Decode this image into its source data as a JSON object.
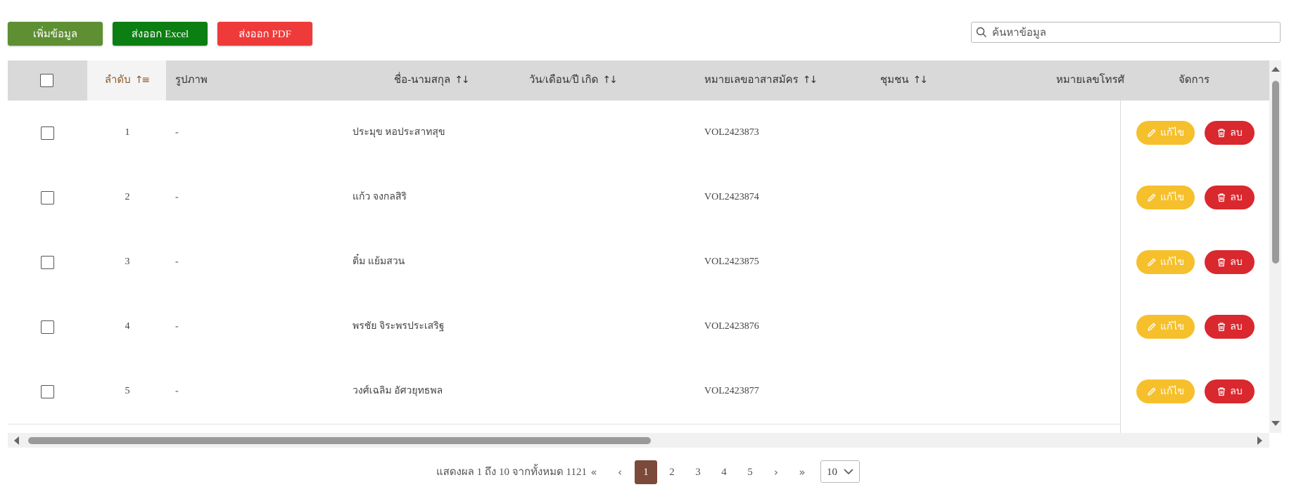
{
  "toolbar": {
    "add_label": "เพิ่มข้อมูล",
    "excel_label": "ส่งออก Excel",
    "pdf_label": "ส่งออก PDF"
  },
  "search": {
    "placeholder": "ค้นหาข้อมูล",
    "value": ""
  },
  "table": {
    "headers": {
      "index": "ลำดับ",
      "photo": "รูปภาพ",
      "name": "ชื่อ-นามสกุล",
      "birthdate": "วัน/เดือน/ปี เกิด",
      "volunteer_no": "หมายเลขอาสาสมัคร",
      "community": "ชุมชน",
      "phone": "หมายเลขโทรศั",
      "actions": "จัดการ"
    },
    "sort_asc_icon": "↑≡",
    "sort_icon": "↑↓",
    "rows": [
      {
        "index": "1",
        "photo": "-",
        "name": "ประมุข หอประสาทสุข",
        "volunteer_no": "VOL2423873"
      },
      {
        "index": "2",
        "photo": "-",
        "name": "แก้ว จงกลสิริ",
        "volunteer_no": "VOL2423874"
      },
      {
        "index": "3",
        "photo": "-",
        "name": "ติ๋ม แย้มสวน",
        "volunteer_no": "VOL2423875"
      },
      {
        "index": "4",
        "photo": "-",
        "name": "พรชัย จิระพรประเสริฐ",
        "volunteer_no": "VOL2423876"
      },
      {
        "index": "5",
        "photo": "-",
        "name": "วงศ์เฉลิม อัศวยุทธพล",
        "volunteer_no": "VOL2423877"
      }
    ],
    "edit_label": "แก้ไข",
    "delete_label": "ลบ"
  },
  "pagination": {
    "info": "แสดงผล 1 ถึง 10 จากทั้งหมด 1121",
    "first": "«",
    "prev": "‹",
    "pages": [
      "1",
      "2",
      "3",
      "4",
      "5"
    ],
    "current": "1",
    "next": "›",
    "last": "»",
    "page_size": "10"
  },
  "colors": {
    "add": "#5e8f32",
    "excel": "#0b7f12",
    "pdf": "#ef3a3a",
    "edit": "#f6c02c",
    "delete": "#d9282e",
    "active_page": "#7b4a3a"
  }
}
